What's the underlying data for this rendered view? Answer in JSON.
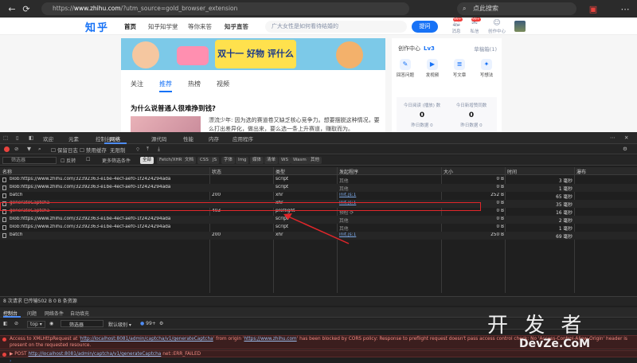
{
  "browser": {
    "url_prefix": "https://",
    "url_host": "www.zhihu.com",
    "url_path": "/?utm_source=gold_browser_extension",
    "search_placeholder": "点此搜索"
  },
  "zhihu": {
    "logo": "知乎",
    "nav": [
      "首页",
      "知乎知学堂",
      "等你来答",
      "知乎直答"
    ],
    "search_placeholder": "广大女性是如何看待结婚的",
    "ask_button": "提问",
    "header_icons": [
      {
        "label": "消息",
        "badge": "99+"
      },
      {
        "label": "私信",
        "badge": "99+"
      },
      {
        "label": "创作中心",
        "badge": ""
      }
    ],
    "banner_text": "双十一 好物 评什么",
    "tabs": [
      "关注",
      "推荐",
      "热榜",
      "视频"
    ],
    "question_title": "为什么说普通人很难挣到钱?",
    "question_excerpt": "漂流少年: 因为选的赛道卷又缺乏核心竞争力。想要摆脱这种情况，要么打出差异化，做出来，要么选一条上升赛道，赚取而为。",
    "creator": {
      "label": "创作中心",
      "level": "Lv3",
      "drafts": "草稿箱(1)"
    },
    "tools": [
      "回答问题",
      "发视频",
      "写文章",
      "写想法"
    ],
    "stats": [
      {
        "label": "今日阅读 (播放) 数",
        "value": "0",
        "sub": "昨日数据 0"
      },
      {
        "label": "今日新增赞同数",
        "value": "0",
        "sub": "昨日数据 0"
      }
    ]
  },
  "devtools": {
    "tabs": [
      "欢迎",
      "元素",
      "控制台",
      "源代码",
      "网络",
      "性能",
      "内存",
      "应用程序"
    ],
    "active_tab": "网络",
    "toolbar": {
      "preserve_log": "保留日志",
      "disable_cache": "禁用缓存",
      "throttle": "无限制"
    },
    "filter": {
      "placeholder": "筛选器",
      "invert": "反转",
      "more_filters": "更多筛选条件",
      "chips": [
        "全部",
        "Fetch/XHR",
        "文档",
        "CSS",
        "JS",
        "字体",
        "Img",
        "媒体",
        "清单",
        "WS",
        "Wasm",
        "其他"
      ]
    },
    "columns": [
      "名称",
      "状态",
      "类型",
      "发起程序",
      "大小",
      "时间",
      "瀑布"
    ],
    "rows": [
      {
        "name": "blob:https://www.zhihu.com/32392363-e1be-4ecf-aef0-1f2424294ada",
        "status": "",
        "type": "script",
        "initiator": "其他",
        "size": "0 B",
        "time": "3 毫秒"
      },
      {
        "name": "blob:https://www.zhihu.com/32392363-e1be-4ecf-aef0-1f2424294ada",
        "status": "",
        "type": "script",
        "initiator": "其他",
        "size": "0 B",
        "time": "1 毫秒"
      },
      {
        "name": "batch",
        "status": "200",
        "type": "xhr",
        "initiator": "init.js:1",
        "size": "252 B",
        "time": "65 毫秒"
      },
      {
        "name": "generateCaptcha",
        "status": "",
        "type": "xhr",
        "initiator": "init.js:1",
        "size": "0 B",
        "time": "35 毫秒"
      },
      {
        "name": "generateCaptcha",
        "status": "403",
        "type": "preflight",
        "initiator": "预检 ⟳",
        "size": "0 B",
        "time": "16 毫秒"
      },
      {
        "name": "blob:https://www.zhihu.com/32392363-e1be-4ecf-aef0-1f2424294ada",
        "status": "",
        "type": "script",
        "initiator": "其他",
        "size": "0 B",
        "time": "2 毫秒"
      },
      {
        "name": "blob:https://www.zhihu.com/32392363-e1be-4ecf-aef0-1f2424294ada",
        "status": "",
        "type": "script",
        "initiator": "其他",
        "size": "0 B",
        "time": "1 毫秒"
      },
      {
        "name": "batch",
        "status": "200",
        "type": "xhr",
        "initiator": "init.js:1",
        "size": "250 B",
        "time": "69 毫秒"
      }
    ],
    "summary": "8 次请求  已传输502 B  0 B 条资源",
    "console_tabs": [
      "控制台",
      "问题",
      "网络条件",
      "自动填充"
    ],
    "console_toolbar": {
      "context": "top",
      "filter": "筛选器",
      "levels": "默认级别",
      "issues": "99+"
    },
    "console_messages": [
      {
        "kind": "err",
        "prefix": "Access to XMLHttpRequest at '",
        "url": "http://localhost:8081/admin/captcha/v1/generateCaptcha",
        "mid": "' from origin '",
        "origin": "https://www.zhihu.com",
        "suffix": "' has been blocked by CORS policy: Response to preflight request doesn't pass access control check: No 'Access-Control-Allow-Origin' header is present on the requested resource."
      },
      {
        "kind": "err",
        "prefix": "▶ POST ",
        "url": "http://localhost:8081/admin/captcha/v1/generateCaptcha",
        "mid": " net::ERR_FAILED",
        "origin": "",
        "suffix": ""
      }
    ]
  },
  "watermark": {
    "line1": "开 发 者",
    "line2": "DevZe.CoM"
  }
}
